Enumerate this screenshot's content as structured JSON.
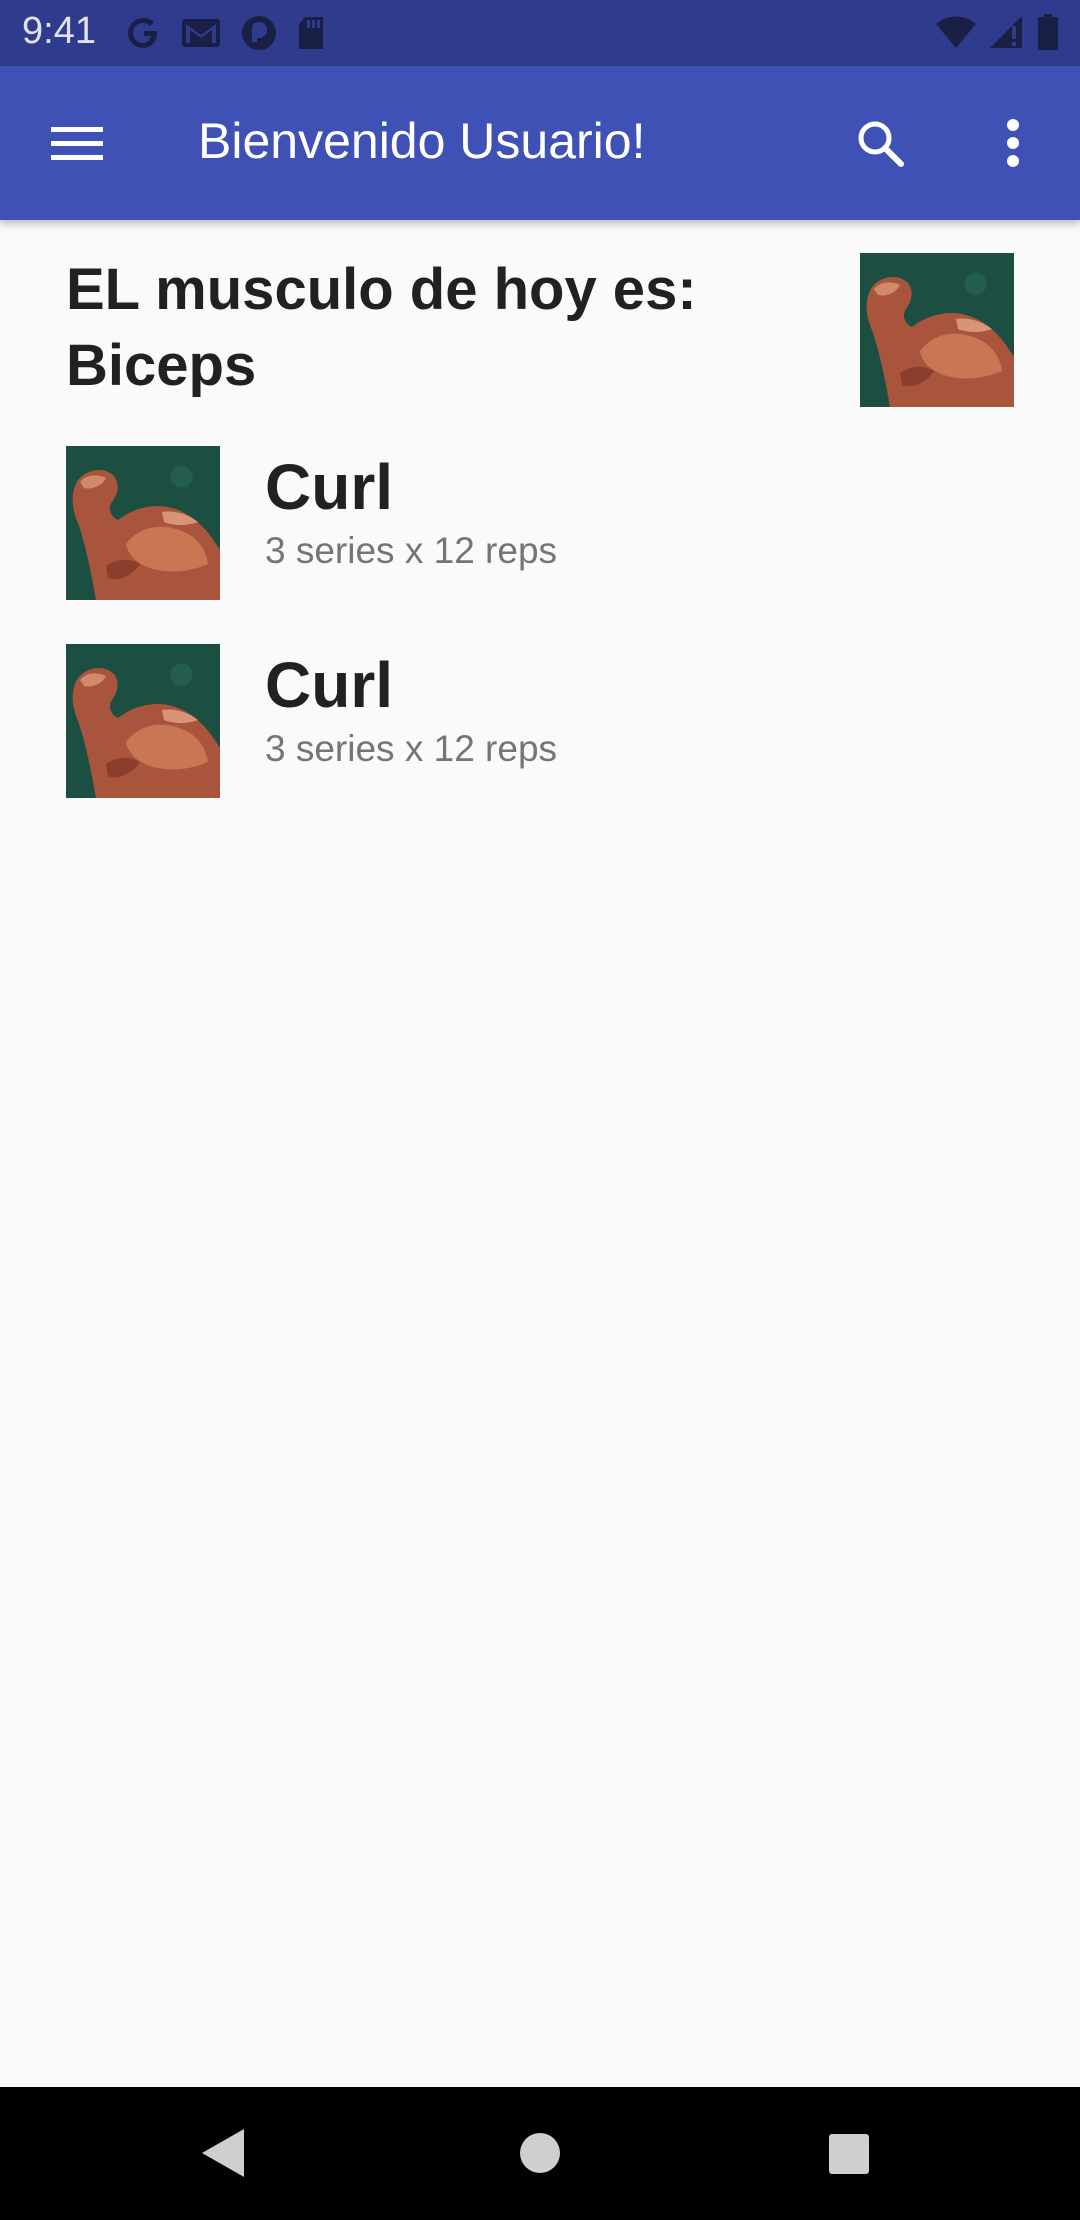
{
  "status_bar": {
    "time": "9:41",
    "left_icons": [
      "google-icon",
      "gmail-icon",
      "pocket-casts-icon",
      "sd-card-icon"
    ],
    "right_icons": [
      "wifi-icon",
      "signal-icon",
      "battery-icon"
    ]
  },
  "app_bar": {
    "title": "Bienvenido Usuario!",
    "menu_icon": "menu-icon",
    "search_icon": "search-icon",
    "more_icon": "more-vert-icon",
    "color": "#3f51b5"
  },
  "muscle": {
    "title": "EL musculo de hoy es: Biceps"
  },
  "exercises": [
    {
      "name": "Curl",
      "detail": "3 series x 12 reps"
    },
    {
      "name": "Curl",
      "detail": "3 series x 12 reps"
    }
  ],
  "nav_bar": {
    "back_icon": "back-icon",
    "home_icon": "home-icon",
    "recents_icon": "recents-icon"
  }
}
